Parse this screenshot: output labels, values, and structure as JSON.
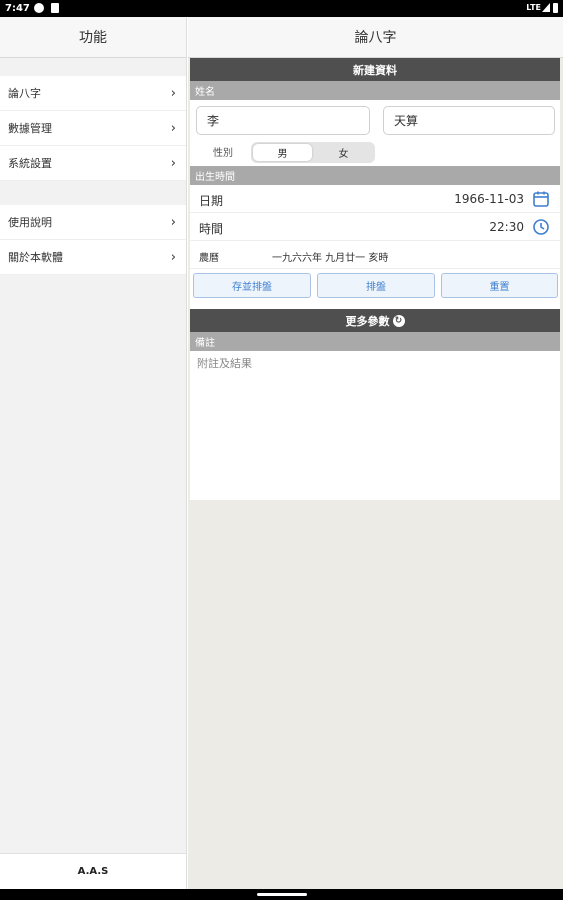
{
  "status": {
    "time": "7:47",
    "network": "LTE"
  },
  "sidebar": {
    "title": "功能",
    "items_group1": [
      {
        "label": "論八字"
      },
      {
        "label": "數據管理"
      },
      {
        "label": "系統設置"
      }
    ],
    "items_group2": [
      {
        "label": "使用說明"
      },
      {
        "label": "關於本軟體"
      }
    ],
    "footer": "A.A.S"
  },
  "main": {
    "title": "論八字",
    "section_new": "新建資料",
    "name_label": "姓名",
    "surname_value": "李",
    "given_name_value": "天算",
    "gender_label": "性別",
    "gender_options": [
      "男",
      "女"
    ],
    "gender_selected": "男",
    "birth_label": "出生時間",
    "date_label": "日期",
    "date_value": "1966-11-03",
    "time_label": "時間",
    "time_value": "22:30",
    "lunar_label": "農曆",
    "lunar_value": "一九六六年 九月廿一 亥時",
    "buttons": {
      "save_chart": "存並排盤",
      "chart": "排盤",
      "reset": "重置"
    },
    "more_params": "更多參數",
    "notes_label": "備註",
    "notes_placeholder": "附註及結果"
  },
  "colors": {
    "accent": "#3e7fce",
    "dark_bar": "#4f4f4f",
    "gray_bar": "#a9a9a9"
  }
}
